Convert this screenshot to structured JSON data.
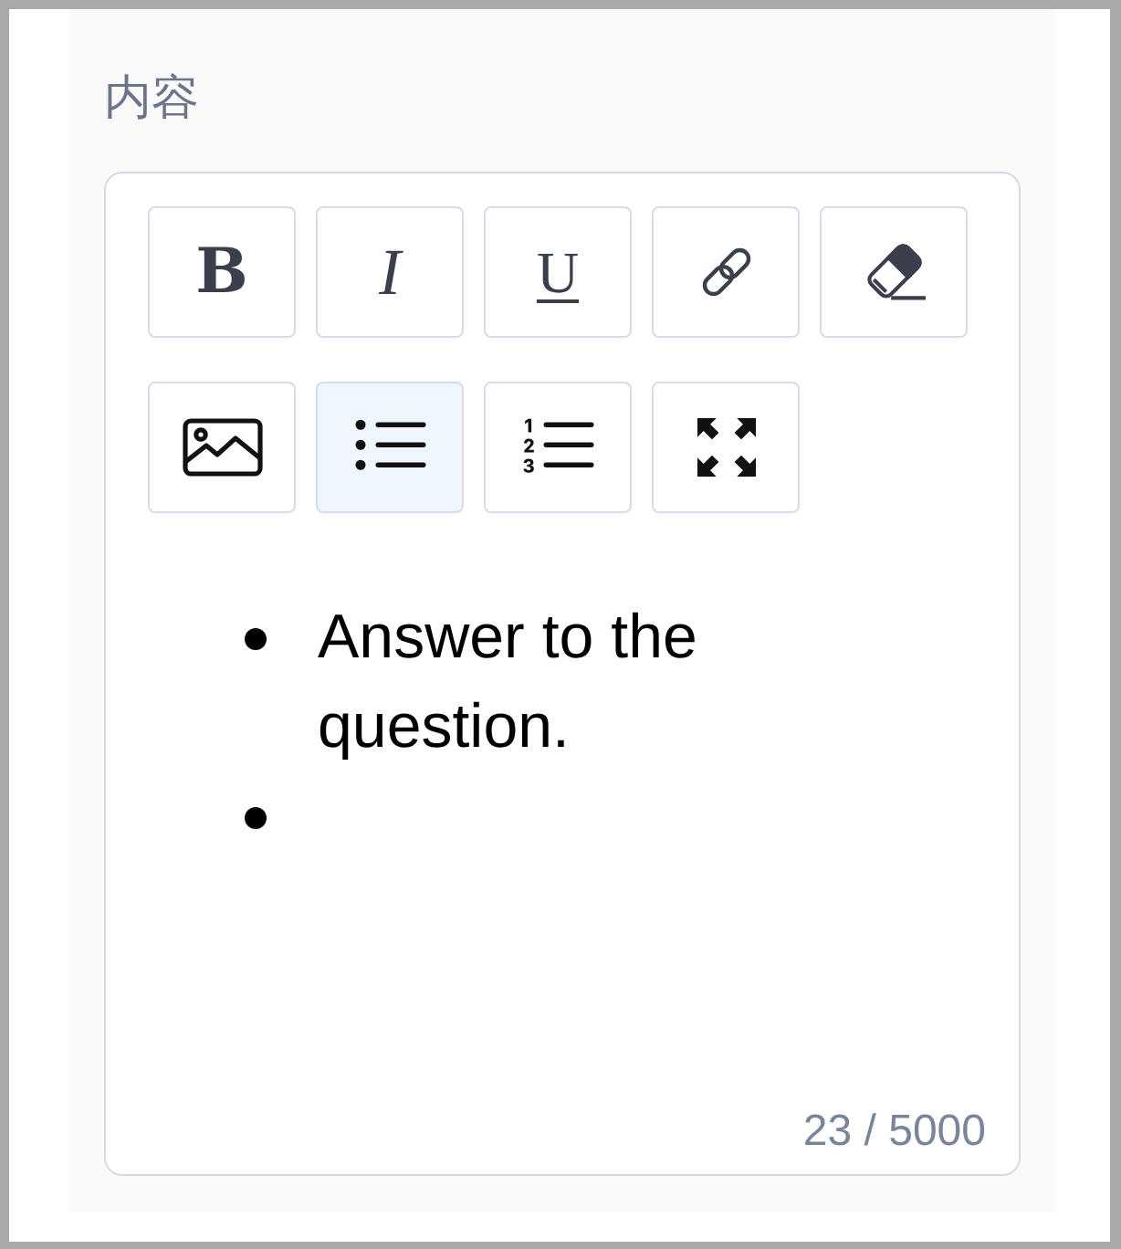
{
  "field": {
    "label": "内容"
  },
  "toolbar": {
    "buttons": [
      {
        "kind": "bold",
        "label": "B",
        "selected": false
      },
      {
        "kind": "italic",
        "label": "I",
        "selected": false
      },
      {
        "kind": "underline",
        "label": "U",
        "selected": false
      },
      {
        "kind": "link",
        "selected": false
      },
      {
        "kind": "eraser",
        "selected": false
      },
      {
        "kind": "image",
        "selected": false
      },
      {
        "kind": "bullet_list",
        "selected": true
      },
      {
        "kind": "numbered_list",
        "selected": false
      },
      {
        "kind": "fullscreen",
        "selected": false
      }
    ]
  },
  "content": {
    "list_items": [
      {
        "kind": "text",
        "text": "Answer to the question."
      },
      {
        "kind": "empty"
      }
    ]
  },
  "counter": "23 / 5000"
}
